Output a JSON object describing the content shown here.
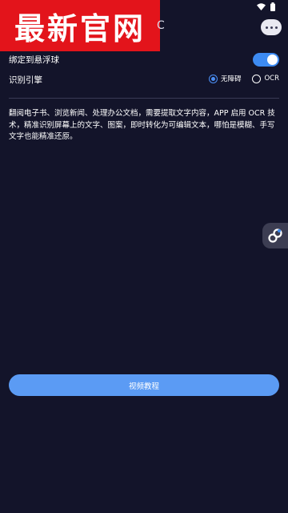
{
  "banner": {
    "text": "最新官网"
  },
  "header": {
    "title_tail": "C"
  },
  "settings": {
    "float_ball_label": "绑定到悬浮球",
    "float_ball_enabled": true,
    "engine_label": "识别引擎",
    "engine_options": [
      "无障碍",
      "OCR"
    ],
    "engine_selected": "无障碍"
  },
  "description": "翻阅电子书、浏览新闻、处理办公文档，需要提取文字内容，APP 启用 OCR 技术，精准识别屏幕上的文字、图案，即时转化为可编辑文本，哪怕是模糊、手写文字也能精准还原。",
  "actions": {
    "tutorial_label": "视频教程"
  },
  "colors": {
    "background": "#13142a",
    "accent": "#3d8bf2",
    "banner": "#e3141b",
    "button": "#5b9bf4"
  },
  "icons": [
    "wifi-icon",
    "battery-icon",
    "more-icon",
    "float-link-icon"
  ]
}
